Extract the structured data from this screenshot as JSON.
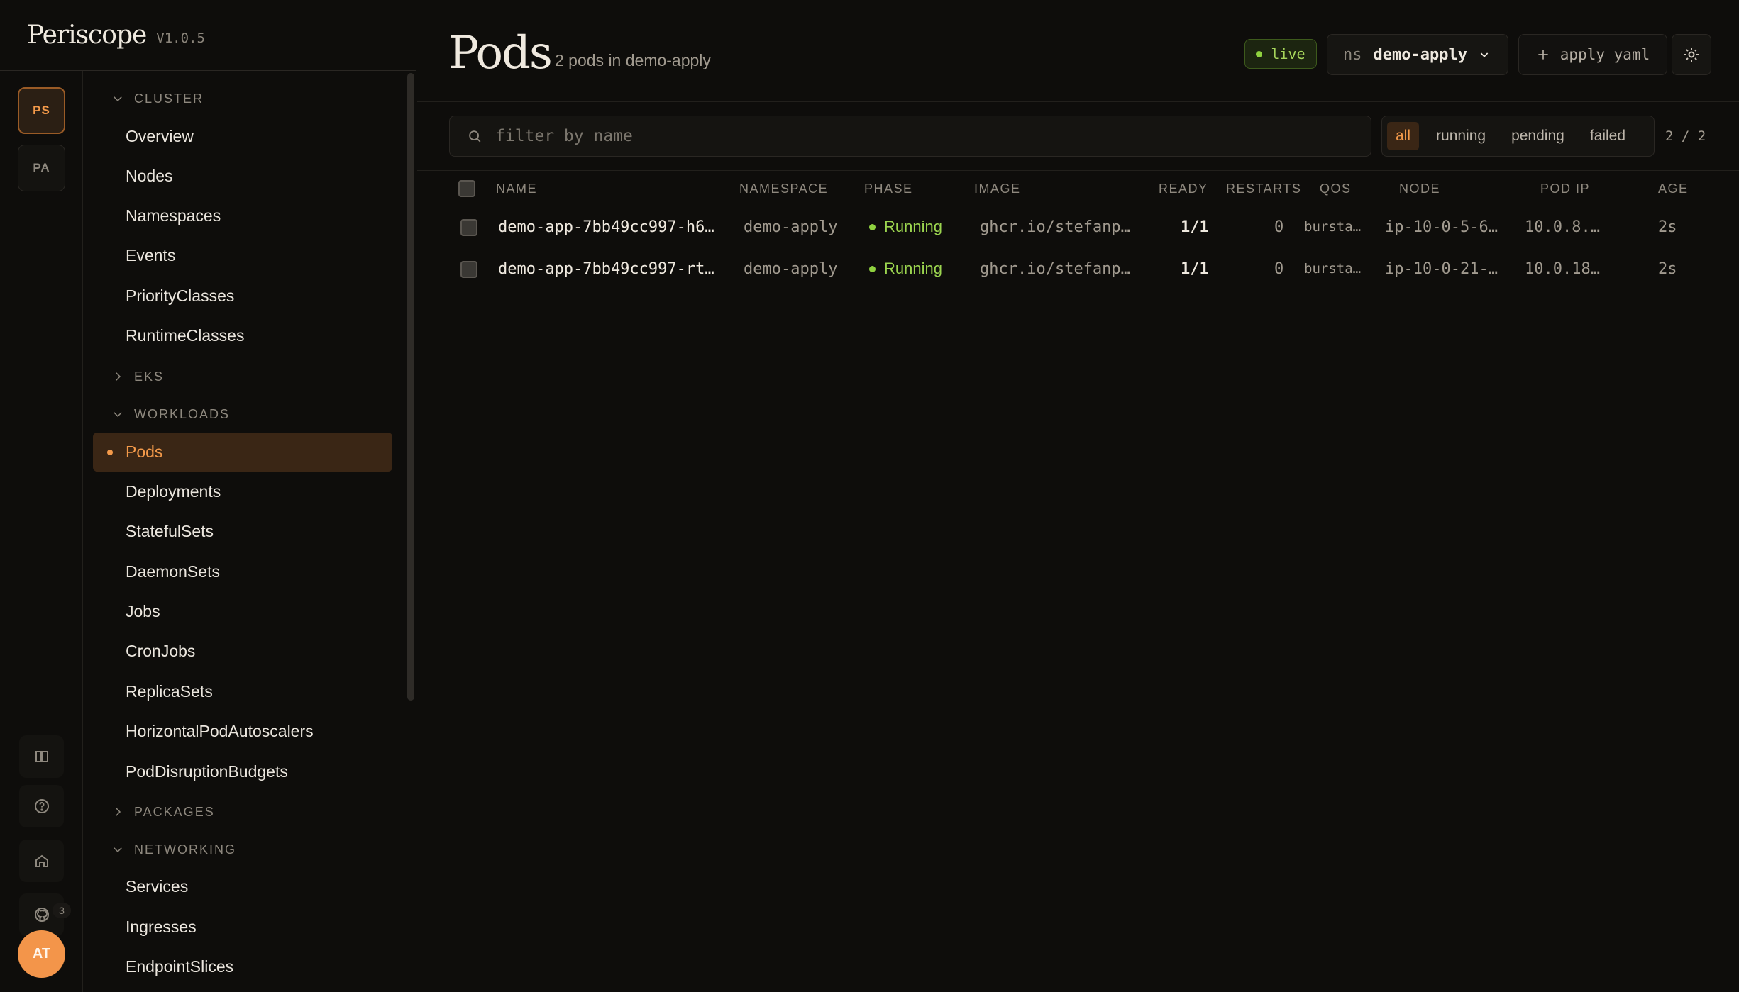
{
  "brand": {
    "name": "Periscope",
    "version": "V1.0.5"
  },
  "rail": {
    "contexts": [
      {
        "label": "PS"
      },
      {
        "label": "PA"
      }
    ],
    "badge": "3",
    "avatar": "AT"
  },
  "nav": {
    "sections": [
      {
        "label": "CLUSTER",
        "expanded": true,
        "items": [
          "Overview",
          "Nodes",
          "Namespaces",
          "Events",
          "PriorityClasses",
          "RuntimeClasses"
        ]
      },
      {
        "label": "EKS",
        "expanded": false,
        "items": []
      },
      {
        "label": "WORKLOADS",
        "expanded": true,
        "items": [
          "Pods",
          "Deployments",
          "StatefulSets",
          "DaemonSets",
          "Jobs",
          "CronJobs",
          "ReplicaSets",
          "HorizontalPodAutoscalers",
          "PodDisruptionBudgets"
        ]
      },
      {
        "label": "PACKAGES",
        "expanded": false,
        "items": []
      },
      {
        "label": "NETWORKING",
        "expanded": true,
        "items": [
          "Services",
          "Ingresses",
          "EndpointSlices"
        ]
      }
    ],
    "active": "Pods"
  },
  "header": {
    "title": "Pods",
    "subtitle": "2 pods in demo-apply",
    "live_label": "live",
    "ns_label": "ns",
    "ns_value": "demo-apply",
    "apply_label": "apply yaml"
  },
  "filter": {
    "placeholder": "filter by name",
    "value": "",
    "phases": [
      "all",
      "running",
      "pending",
      "failed"
    ],
    "active_phase": "all",
    "count": "2 / 2"
  },
  "table": {
    "columns": [
      "NAME",
      "NAMESPACE",
      "PHASE",
      "IMAGE",
      "READY",
      "RESTARTS",
      "QOS",
      "NODE",
      "POD IP",
      "AGE"
    ],
    "rows": [
      {
        "name": "demo-app-7bb49cc997-h6…",
        "namespace": "demo-apply",
        "phase": "Running",
        "image": "ghcr.io/stefanp…",
        "ready": "1/1",
        "restarts": "0",
        "qos": "bursta…",
        "node": "ip-10-0-5-6…",
        "pod_ip": "10.0.8.…",
        "age": "2s"
      },
      {
        "name": "demo-app-7bb49cc997-rt…",
        "namespace": "demo-apply",
        "phase": "Running",
        "image": "ghcr.io/stefanp…",
        "ready": "1/1",
        "restarts": "0",
        "qos": "bursta…",
        "node": "ip-10-0-21-…",
        "pod_ip": "10.0.18…",
        "age": "2s"
      }
    ]
  },
  "colors": {
    "accent": "#f49a4a",
    "running": "#9bd44f",
    "background": "#0e0d0b"
  }
}
